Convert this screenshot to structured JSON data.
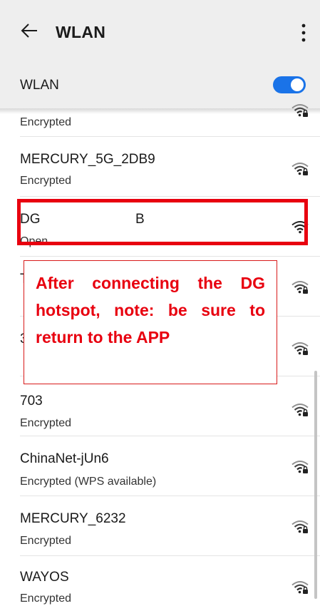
{
  "header": {
    "title": "WLAN"
  },
  "wlan_toggle": {
    "label": "WLAN",
    "state": "on",
    "accent_color": "#1a73e8"
  },
  "networks": [
    {
      "name": "",
      "status": "Encrypted",
      "signal_icon": "wifi-locked-icon"
    },
    {
      "name": "MERCURY_5G_2DB9",
      "status": "Encrypted",
      "signal_icon": "wifi-locked-icon"
    },
    {
      "name": "DG",
      "suffix": "B",
      "status": "Open",
      "signal_icon": "wifi-open-icon"
    },
    {
      "name": "T",
      "status": "",
      "signal_icon": "wifi-locked-icon"
    },
    {
      "name": "3",
      "status": "",
      "signal_icon": "wifi-locked-icon"
    },
    {
      "name": "703",
      "status": "Encrypted",
      "signal_icon": "wifi-locked-icon"
    },
    {
      "name": "ChinaNet-jUn6",
      "status": "Encrypted (WPS available)",
      "signal_icon": "wifi-locked-icon"
    },
    {
      "name": "MERCURY_6232",
      "status": "Encrypted",
      "signal_icon": "wifi-locked-icon"
    },
    {
      "name": "WAYOS",
      "status": "Encrypted",
      "signal_icon": "wifi-locked-icon"
    }
  ],
  "annotation": {
    "text": "After connecting the DG hotspot, note: be sure to return to the APP",
    "color": "#e8000f"
  }
}
